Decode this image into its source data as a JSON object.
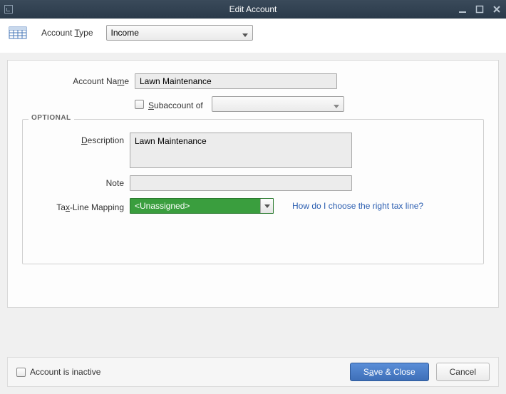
{
  "window": {
    "title": "Edit Account"
  },
  "top": {
    "account_type_label_prefix": "Account ",
    "account_type_label_u": "T",
    "account_type_label_suffix": "ype",
    "account_type_value": "Income"
  },
  "form": {
    "account_name_label_prefix": "Account Na",
    "account_name_label_u": "m",
    "account_name_label_suffix": "e",
    "account_name_value": "Lawn Maintenance",
    "subaccount_label_u": "S",
    "subaccount_label_suffix": "ubaccount of",
    "subaccount_value": ""
  },
  "optional": {
    "legend": "OPTIONAL",
    "description_label_u": "D",
    "description_label_suffix": "escription",
    "description_value": "Lawn Maintenance",
    "note_label": "Note",
    "note_value": "",
    "taxline_label_prefix": "Ta",
    "taxline_label_u": "x",
    "taxline_label_suffix": "-Line Mapping",
    "taxline_value": "<Unassigned>",
    "tax_help_link": "How do I choose the right tax line?"
  },
  "footer": {
    "inactive_label": "Account is inactive",
    "save_close_prefix": "S",
    "save_close_u": "a",
    "save_close_suffix": "ve & Close",
    "cancel": "Cancel"
  }
}
